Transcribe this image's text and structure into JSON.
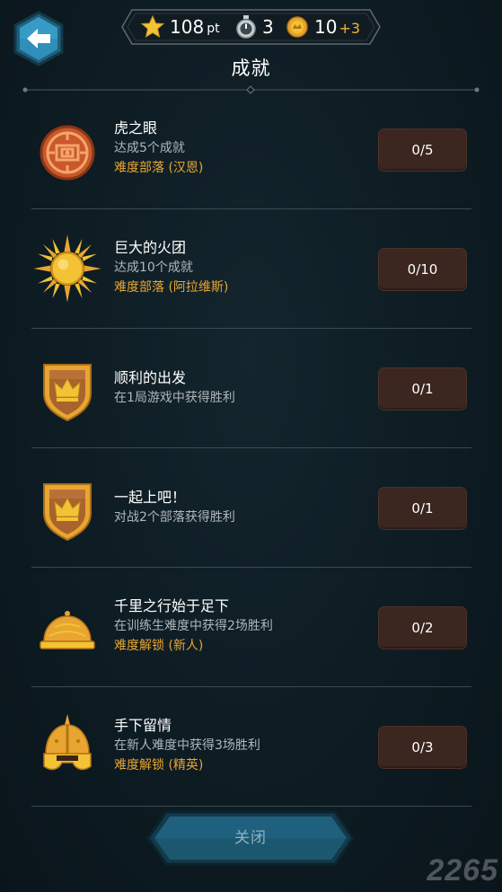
{
  "header": {
    "points_value": "108",
    "points_unit": "pt",
    "timer_value": "3",
    "coins_value": "10",
    "coins_bonus": "+3",
    "title": "成就"
  },
  "achievements": [
    {
      "name": "虎之眼",
      "desc": "达成5个成就",
      "req": "难度部落 (汉恩)",
      "progress": "0/5",
      "icon": "tiger-eye-emblem-icon"
    },
    {
      "name": "巨大的火团",
      "desc": "达成10个成就",
      "req": "难度部落 (阿拉维斯)",
      "progress": "0/10",
      "icon": "sun-icon"
    },
    {
      "name": "顺利的出发",
      "desc": "在1局游戏中获得胜利",
      "req": "",
      "progress": "0/1",
      "icon": "crown-shield-icon"
    },
    {
      "name": "一起上吧！",
      "desc": "对战2个部落获得胜利",
      "req": "",
      "progress": "0/1",
      "icon": "crown-shield-icon"
    },
    {
      "name": "千里之行始于足下",
      "desc": "在训练生难度中获得2场胜利",
      "req": "难度解锁 (新人)",
      "progress": "0/2",
      "icon": "dome-helmet-icon"
    },
    {
      "name": "手下留情",
      "desc": "在新人难度中获得3场胜利",
      "req": "难度解锁 (精英)",
      "progress": "0/3",
      "icon": "spiked-helmet-icon"
    }
  ],
  "footer": {
    "close_label": "关闭",
    "watermark": "2265"
  },
  "colors": {
    "background": "#0d1b22",
    "accent_gold": "#e8a531",
    "progress_bg": "#3b2620",
    "back_button": "#2f8fb8"
  }
}
